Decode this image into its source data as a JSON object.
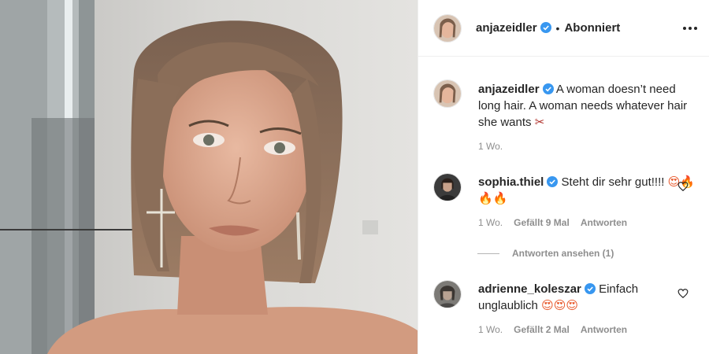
{
  "post": {
    "author": "anjazeidler",
    "follow_status": "Abonniert",
    "separator": "•"
  },
  "caption": {
    "author": "anjazeidler",
    "text": "A woman doesn’t need long hair. A woman needs whatever hair she wants ",
    "emoji": "✂",
    "time": "1 Wo."
  },
  "comments": [
    {
      "author": "sophia.thiel",
      "text": "Steht dir sehr gut!!!! ",
      "emoji": "😍🔥🔥🔥",
      "time": "1 Wo.",
      "likes": "Gefällt 9 Mal",
      "reply": "Antworten",
      "view_replies": "Antworten ansehen (1)"
    },
    {
      "author": "adrienne_koleszar",
      "text": "Einfach unglaublich ",
      "emoji": "😍😍😍",
      "time": "1 Wo.",
      "likes": "Gefällt 2 Mal",
      "reply": "Antworten"
    }
  ],
  "icons": {
    "verified": "verified-badge-icon",
    "more": "more-options-icon",
    "like": "heart-icon"
  },
  "colors": {
    "verified": "#3897f0",
    "secondary_text": "#8e8e8e",
    "primary_text": "#262626"
  }
}
